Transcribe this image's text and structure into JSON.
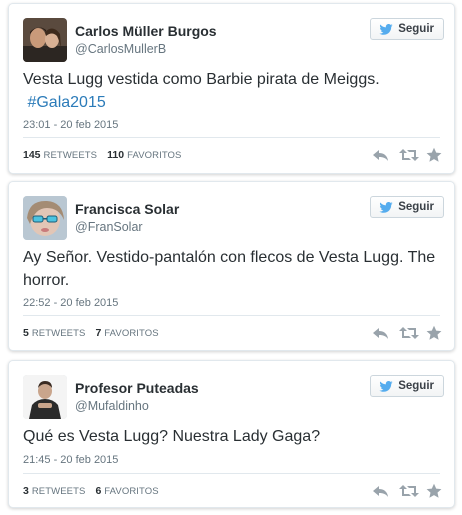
{
  "colors": {
    "accent": "#2b7bb9",
    "twitter_blue": "#55acee",
    "muted": "#66757f",
    "action_icon": "#99a3ab"
  },
  "follow_label": "Seguir",
  "tweets": [
    {
      "name": "Carlos Müller Burgos",
      "handle": "@CarlosMullerB",
      "text": "Vesta Lugg vestida como Barbie pirata de Meiggs.",
      "hashtag": "#Gala2015",
      "time": "23:01 - 20 feb 2015",
      "retweets": "145",
      "retweets_label": "RETWEETS",
      "favorites": "110",
      "favorites_label": "FAVORITOS"
    },
    {
      "name": "Francisca Solar",
      "handle": "@FranSolar",
      "text": "Ay Señor. Vestido-pantalón con flecos de Vesta Lugg. The horror.",
      "time": "22:52 - 20 feb 2015",
      "retweets": "5",
      "retweets_label": "RETWEETS",
      "favorites": "7",
      "favorites_label": "FAVORITOS"
    },
    {
      "name": "Profesor Puteadas",
      "handle": "@Mufaldinho",
      "text": "Qué es Vesta Lugg? Nuestra Lady Gaga?",
      "time": "21:45 - 20 feb 2015",
      "retweets": "3",
      "retweets_label": "RETWEETS",
      "favorites": "6",
      "favorites_label": "FAVORITOS"
    }
  ]
}
